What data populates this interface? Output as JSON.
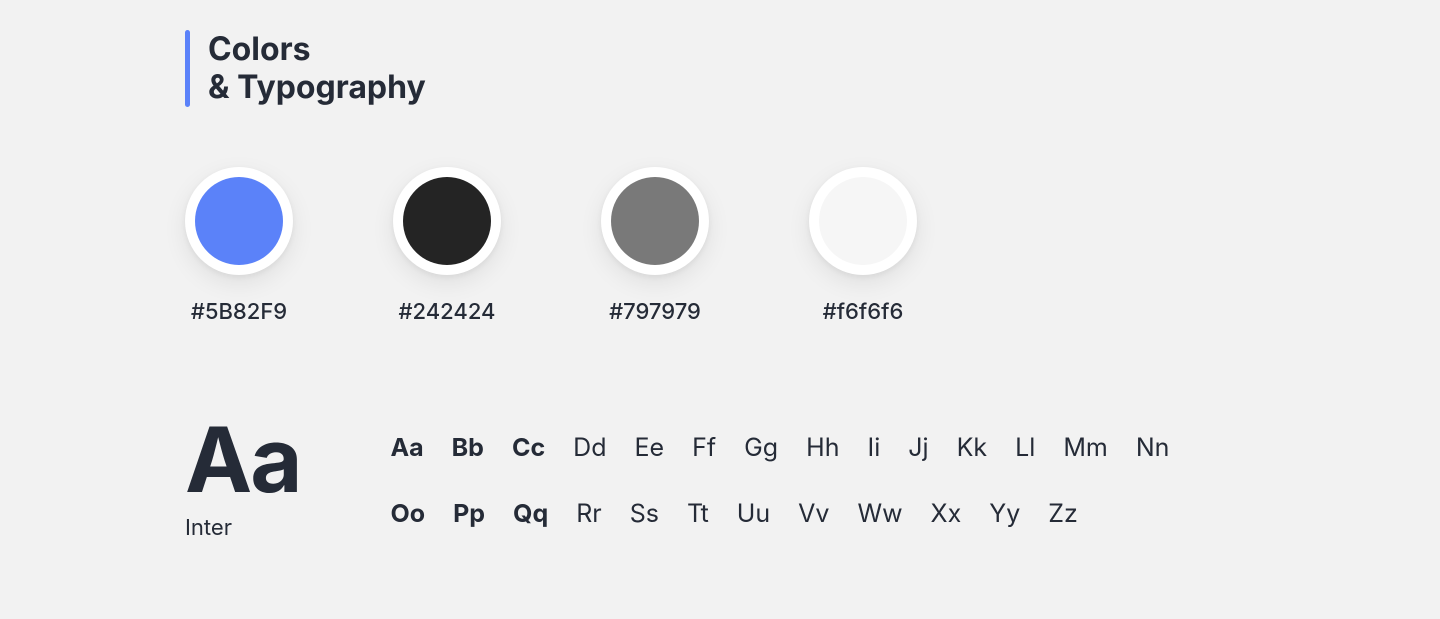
{
  "heading": {
    "line1": "Colors",
    "line2": "& Typography"
  },
  "colors": {
    "swatches": [
      {
        "hex": "#5B82F9",
        "label": "#5B82F9"
      },
      {
        "hex": "#242424",
        "label": "#242424"
      },
      {
        "hex": "#797979",
        "label": "#797979"
      },
      {
        "hex": "#f6f6f6",
        "label": "#f6f6f6"
      }
    ]
  },
  "typography": {
    "sample": "Aa",
    "font_name": "Inter",
    "row1": {
      "bold": [
        "Aa",
        "Bb",
        "Cc"
      ],
      "reg": [
        "Dd",
        "Ee",
        "Ff",
        "Gg",
        "Hh",
        "Ii",
        "Jj",
        "Kk",
        "Ll",
        "Mm",
        "Nn"
      ]
    },
    "row2": {
      "bold": [
        "Oo",
        "Pp",
        "Qq"
      ],
      "reg": [
        "Rr",
        "Ss",
        "Tt",
        "Uu",
        "Vv",
        "Ww",
        "Xx",
        "Yy",
        "Zz"
      ]
    }
  }
}
